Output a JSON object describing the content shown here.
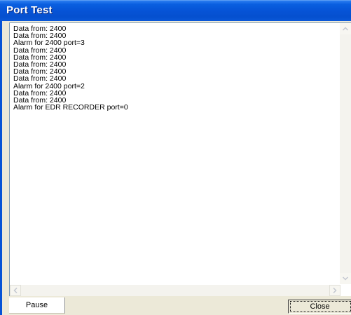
{
  "window": {
    "title": "Port Test"
  },
  "log": {
    "lines": [
      "Data from: 2400",
      "Data from: 2400",
      "Alarm for 2400 port=3",
      "Data from: 2400",
      "Data from: 2400",
      "Data from: 2400",
      "Data from: 2400",
      "Data from: 2400",
      "Alarm for 2400 port=2",
      "Data from: 2400",
      "Data from: 2400",
      "Alarm for EDR RECORDER port=0"
    ]
  },
  "buttons": {
    "pause_label": "Pause",
    "close_label": "Close"
  },
  "colors": {
    "titlebar": "#0653d6",
    "face": "#ece9d8",
    "listbox_bg": "#ffffff"
  },
  "icons": {
    "scroll_up": "chevron-up-icon",
    "scroll_down": "chevron-down-icon",
    "scroll_left": "chevron-left-icon",
    "scroll_right": "chevron-right-icon"
  }
}
